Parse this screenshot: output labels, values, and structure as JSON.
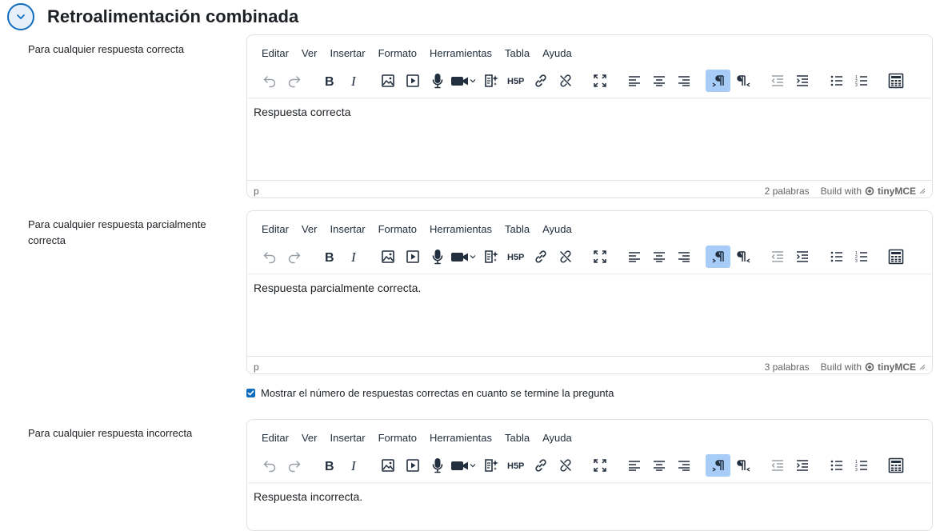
{
  "section": {
    "title": "Retroalimentación combinada",
    "toggle_icon": "chevron-down-icon"
  },
  "menu": [
    "Editar",
    "Ver",
    "Insertar",
    "Formato",
    "Herramientas",
    "Tabla",
    "Ayuda"
  ],
  "editors": [
    {
      "label": "Para cualquier respuesta correcta",
      "content": "Respuesta correcta",
      "path": "p",
      "word_count": "2 palabras",
      "build_with": "Build with",
      "brand": "tinyMCE"
    },
    {
      "label": "Para cualquier respuesta parcialmente correcta",
      "content": "Respuesta parcialmente correcta.",
      "path": "p",
      "word_count": "3 palabras",
      "build_with": "Build with",
      "brand": "tinyMCE"
    },
    {
      "label": "Para cualquier respuesta incorrecta",
      "content": "Respuesta incorrecta.",
      "path": "p",
      "word_count": "",
      "build_with": "",
      "brand": ""
    }
  ],
  "show_correct_count": {
    "label": "Mostrar el número de respuestas correctas en cuanto se termine la pregunta",
    "checked": true
  },
  "colors": {
    "accent": "#0f6cbf",
    "active_button": "#a6ccf7"
  }
}
